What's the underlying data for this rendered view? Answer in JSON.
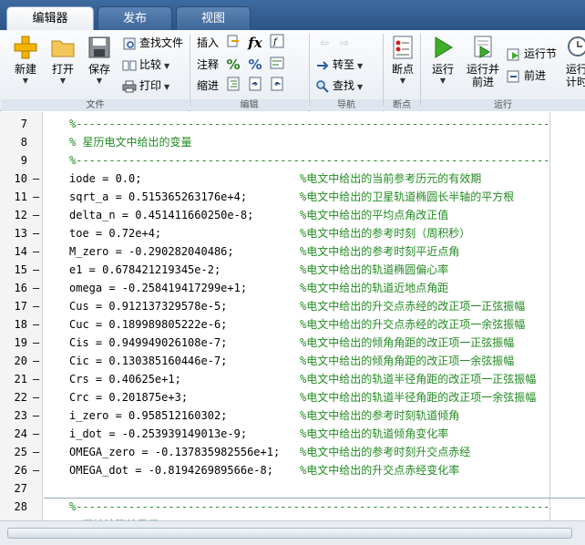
{
  "tabs": [
    "编辑器",
    "发布",
    "视图"
  ],
  "file_group": {
    "new": "新建",
    "open": "打开",
    "save": "保存",
    "find_file": "查找文件",
    "compare": "比较",
    "print": "打印",
    "label": "文件"
  },
  "edit_group": {
    "insert": "插入",
    "comment": "注释",
    "indent": "缩进",
    "fx": "fx",
    "label": "编辑"
  },
  "nav_group": {
    "goto": "转至",
    "find": "查找",
    "label": "导航"
  },
  "breakpoint_group": {
    "breakpoints": "断点",
    "label": "断点"
  },
  "run_group": {
    "run": "运行",
    "run_advance": "运行并\n前进",
    "run_section": "运行节",
    "advance": "前进",
    "run_time": "运行\n计时",
    "label": "运行"
  },
  "editor_lines": [
    {
      "n": "7",
      "dash": "",
      "type": "cell",
      "code": "%------------------------------------------------------------------------",
      "cmt": ""
    },
    {
      "n": "8",
      "dash": "",
      "type": "cellc",
      "code": "% 星历电文中给出的变量",
      "cmt": ""
    },
    {
      "n": "9",
      "dash": "",
      "type": "cell",
      "code": "%------------------------------------------------------------------------",
      "cmt": ""
    },
    {
      "n": "10",
      "dash": "—",
      "type": "code",
      "code": "iode = 0.0;",
      "cmt": "%电文中给出的当前参考历元的有效期"
    },
    {
      "n": "11",
      "dash": "—",
      "type": "code",
      "code": "sqrt_a = 0.515365263176e+4;",
      "cmt": "%电文中给出的卫星轨道椭圆长半轴的平方根"
    },
    {
      "n": "12",
      "dash": "—",
      "type": "code",
      "code": "delta_n = 0.451411660250e-8;",
      "cmt": "%电文中给出的平均点角改正值"
    },
    {
      "n": "13",
      "dash": "—",
      "type": "code",
      "code": "toe = 0.72e+4;",
      "cmt": "%电文中给出的参考时刻（周积秒）"
    },
    {
      "n": "14",
      "dash": "—",
      "type": "code",
      "code": "M_zero = -0.290282040486;",
      "cmt": "%电文中给出的参考时刻平近点角"
    },
    {
      "n": "15",
      "dash": "—",
      "type": "code",
      "code": "e1 = 0.678421219345e-2;",
      "cmt": "%电文中给出的轨道椭圆偏心率"
    },
    {
      "n": "16",
      "dash": "—",
      "type": "code",
      "code": "omega = -0.258419417299e+1;",
      "cmt": "%电文中给出的轨道近地点角距"
    },
    {
      "n": "17",
      "dash": "—",
      "type": "code",
      "code": "Cus = 0.912137329578e-5;",
      "cmt": "%电文中给出的升交点赤经的改正项一正弦振幅"
    },
    {
      "n": "18",
      "dash": "—",
      "type": "code",
      "code": "Cuc = 0.189989805222e-6;",
      "cmt": "%电文中给出的升交点赤经的改正项一余弦振幅"
    },
    {
      "n": "19",
      "dash": "—",
      "type": "code",
      "code": "Cis = 0.949949026108e-7;",
      "cmt": "%电文中给出的倾角角距的改正项一正弦振幅"
    },
    {
      "n": "20",
      "dash": "—",
      "type": "code",
      "code": "Cic = 0.130385160446e-7;",
      "cmt": "%电文中给出的倾角角距的改正项一余弦振幅"
    },
    {
      "n": "21",
      "dash": "—",
      "type": "code",
      "code": "Crs = 0.40625e+1;",
      "cmt": "%电文中给出的轨道半径角距的改正项一正弦振幅"
    },
    {
      "n": "22",
      "dash": "—",
      "type": "code",
      "code": "Crc = 0.201875e+3;",
      "cmt": "%电文中给出的轨道半径角距的改正项一余弦振幅"
    },
    {
      "n": "23",
      "dash": "—",
      "type": "code",
      "code": "i_zero = 0.958512160302;",
      "cmt": "%电文中给出的参考时刻轨道倾角"
    },
    {
      "n": "24",
      "dash": "—",
      "type": "code",
      "code": "i_dot = -0.253939149013e-9;",
      "cmt": "%电文中给出的轨道倾角变化率"
    },
    {
      "n": "25",
      "dash": "—",
      "type": "code",
      "code": "OMEGA_zero = -0.137835982556e+1;",
      "cmt": "%电文中给出的参考时刻升交点赤经"
    },
    {
      "n": "26",
      "dash": "—",
      "type": "code",
      "code": "OMEGA_dot = -0.819426989566e-8;",
      "cmt": "%电文中给出的升交点赤经变化率"
    },
    {
      "n": "27",
      "dash": "",
      "type": "code",
      "code": "",
      "cmt": ""
    },
    {
      "n": "28",
      "dash": "",
      "type": "cell",
      "code": "%------------------------------------------------------------------------",
      "cmt": ""
    },
    {
      "n": "",
      "dash": "",
      "type": "cellc",
      "code": "% 开始计算结果用",
      "cmt": ""
    }
  ]
}
